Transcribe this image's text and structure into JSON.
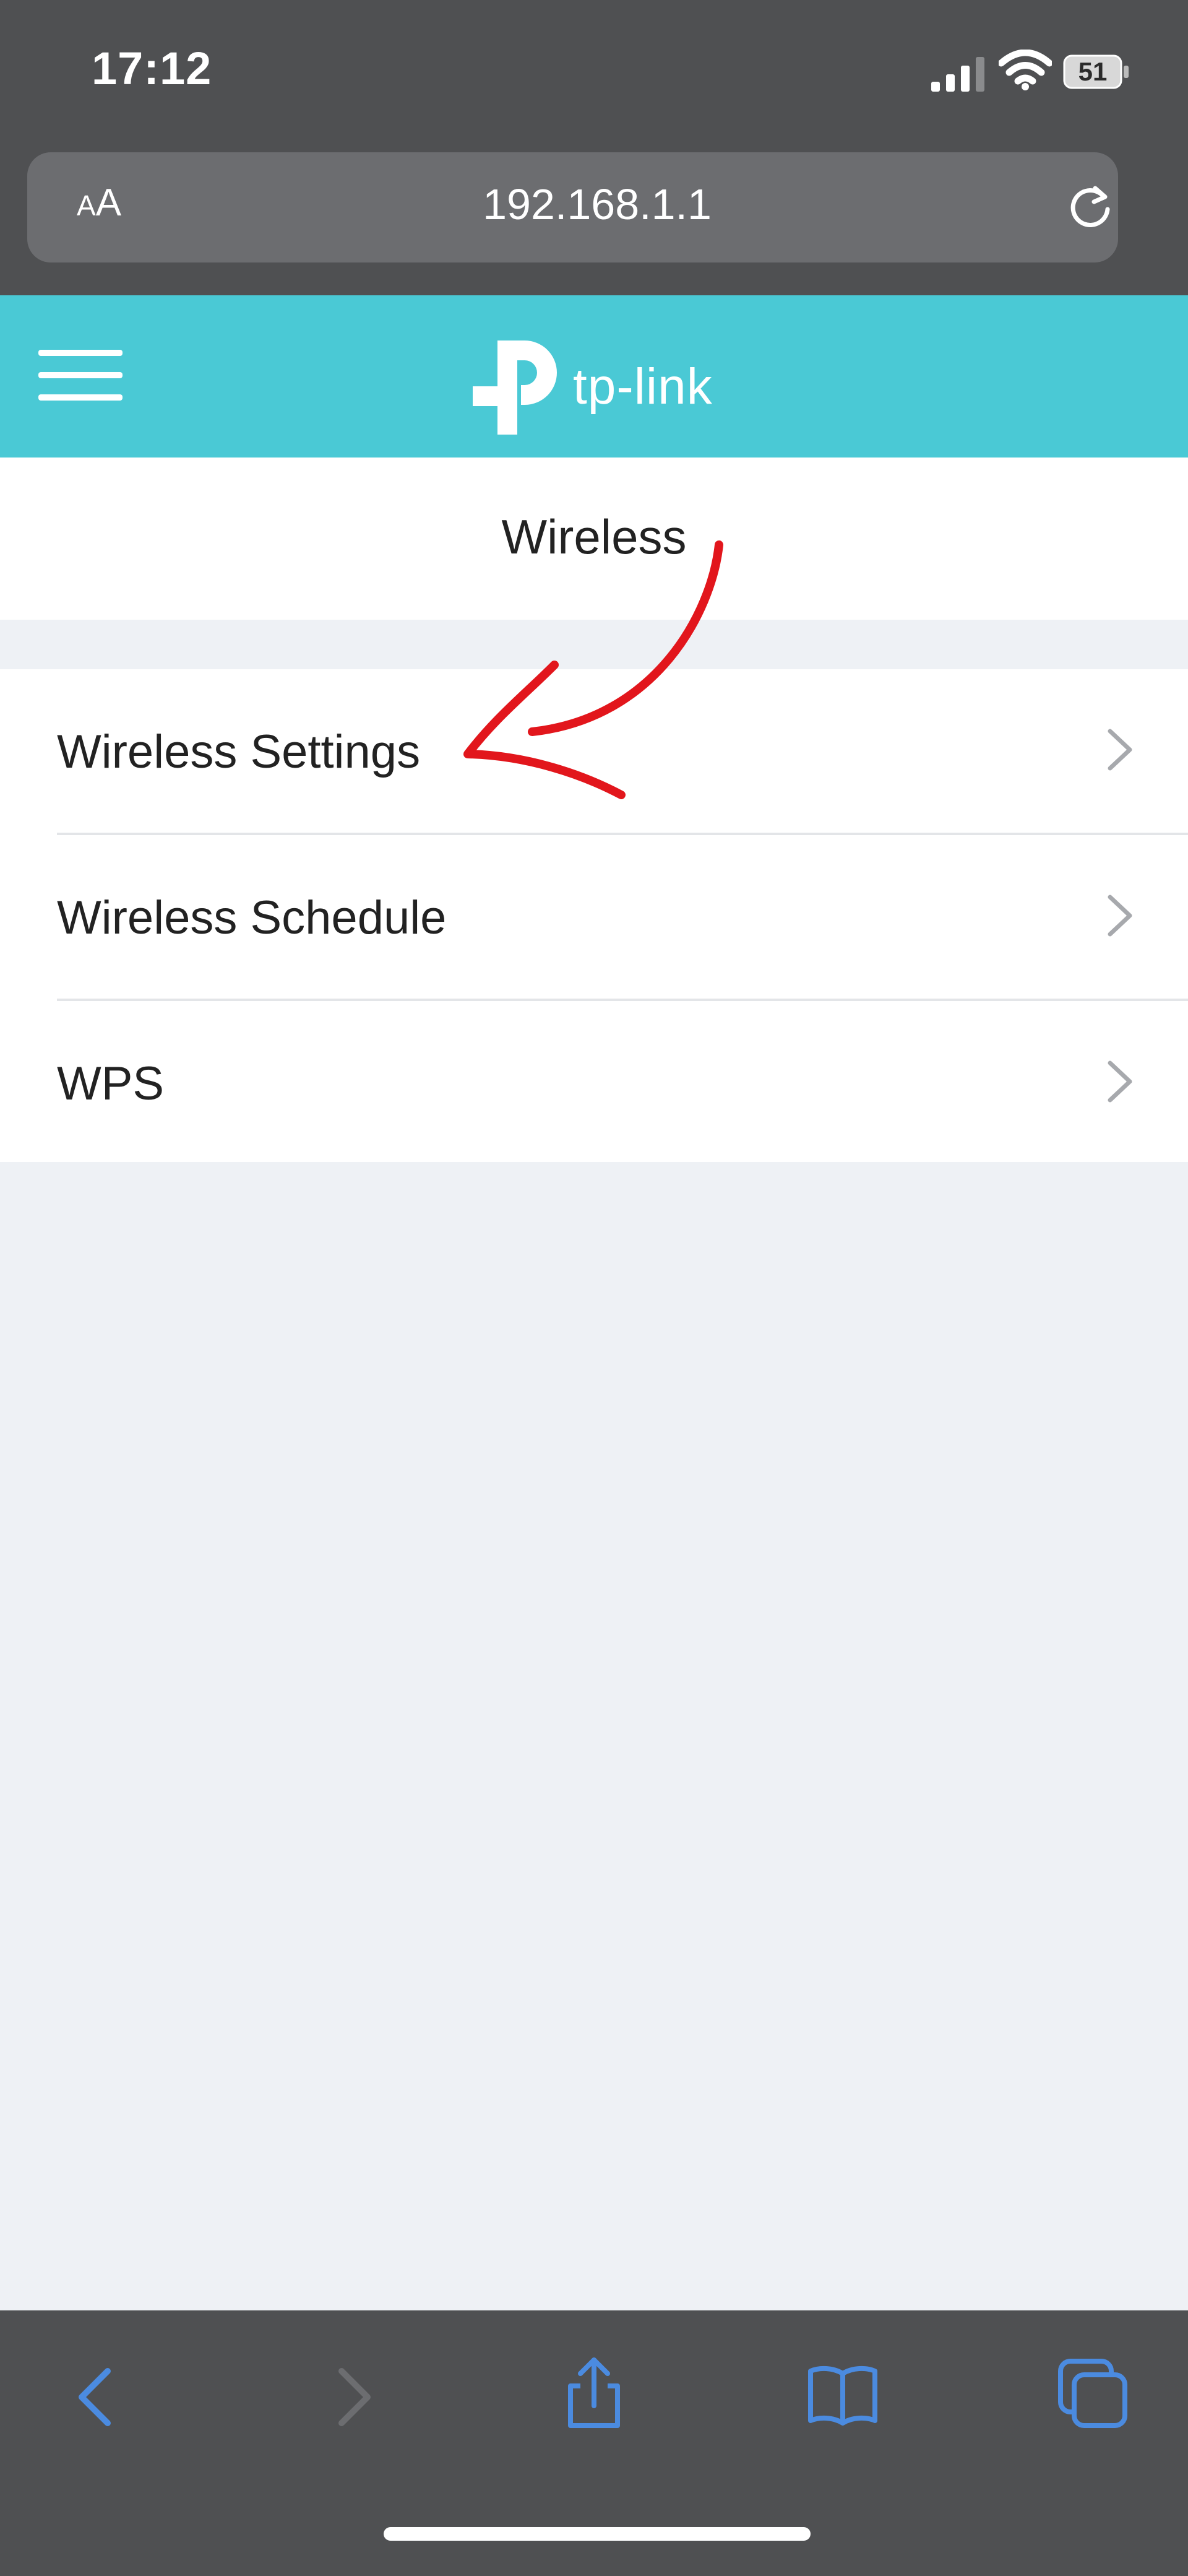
{
  "status_bar": {
    "time": "17:12",
    "battery": "51"
  },
  "browser": {
    "text_size_label_small": "A",
    "text_size_label_large": "A",
    "url": "192.168.1.1"
  },
  "header": {
    "brand": "tp-link",
    "accent_color": "#4ac9d5"
  },
  "page": {
    "title": "Wireless"
  },
  "menu": {
    "items": [
      {
        "label": "Wireless Settings"
      },
      {
        "label": "Wireless Schedule"
      },
      {
        "label": "WPS"
      }
    ]
  },
  "toolbar": {
    "icons": [
      "back-icon",
      "forward-icon",
      "share-icon",
      "bookmarks-icon",
      "tabs-icon"
    ],
    "icon_color": "#4b8be0"
  },
  "annotation": {
    "color": "#e2161c",
    "icon": "red-arrow-annotation"
  }
}
